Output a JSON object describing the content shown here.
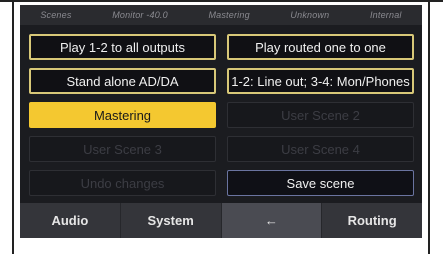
{
  "status_bar": {
    "items": [
      "Scenes",
      "Monitor -40.0",
      "Mastering",
      "Unknown",
      "Internal"
    ]
  },
  "scenes": {
    "play_all": "Play 1-2 to all outputs",
    "play_routed": "Play routed one to one",
    "standalone": "Stand alone AD/DA",
    "line_out": "1-2: Line out; 3-4: Mon/Phones",
    "mastering": "Mastering",
    "user2": "User Scene 2",
    "user3": "User Scene 3",
    "user4": "User Scene 4",
    "undo": "Undo changes",
    "save": "Save scene"
  },
  "nav": {
    "audio": "Audio",
    "system": "System",
    "back_icon": "←",
    "routing": "Routing"
  },
  "colors": {
    "active": "#f4c830",
    "button_border": "#d8c878",
    "background": "#1b1c20"
  }
}
